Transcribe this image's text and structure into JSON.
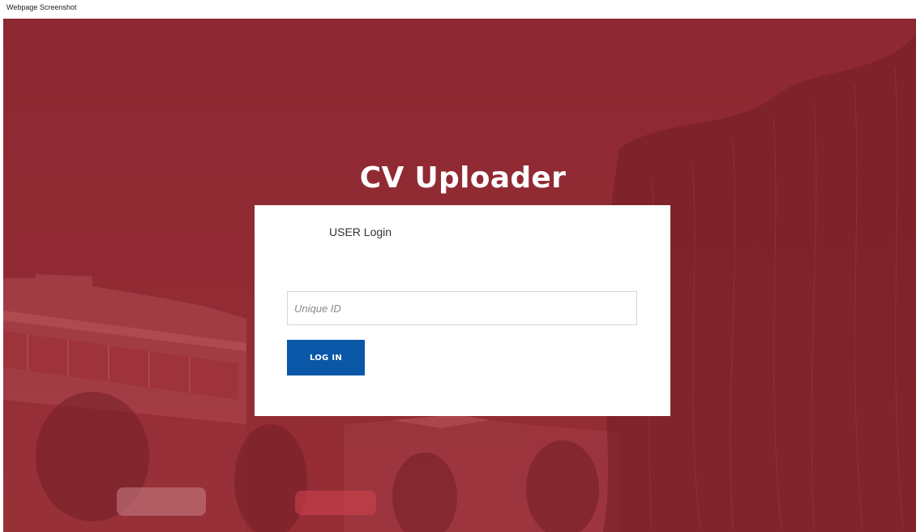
{
  "caption": "Webpage Screenshot",
  "app": {
    "title": "CV Uploader"
  },
  "login": {
    "heading": "USER Login",
    "id_field": {
      "placeholder": "Unique ID",
      "value": ""
    },
    "submit_label": "LOG IN"
  },
  "colors": {
    "overlay": "#8c2630",
    "button": "#0a57a8",
    "card": "#ffffff"
  }
}
